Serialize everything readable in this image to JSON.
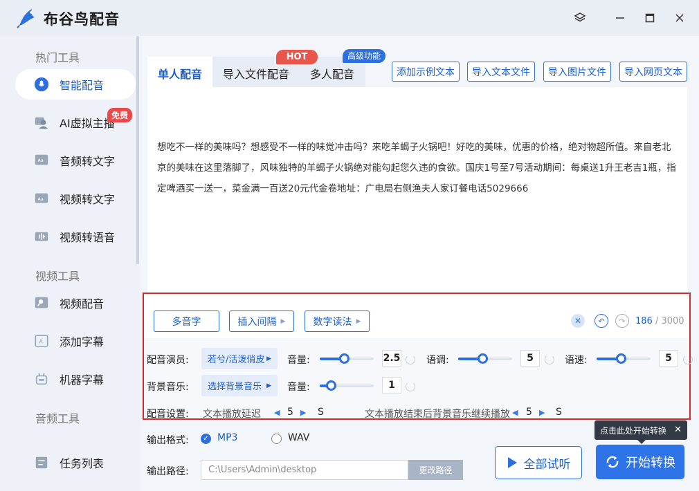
{
  "app": {
    "title": "布谷鸟配音"
  },
  "sidebar": {
    "sections": [
      "热门工具",
      "视频工具",
      "音频工具"
    ],
    "items": [
      {
        "label": "智能配音",
        "icon": "microphone-icon",
        "active": true
      },
      {
        "label": "AI虚拟主播",
        "icon": "avatar-icon",
        "badge": "免费"
      },
      {
        "label": "音频转文字",
        "icon": "audio-text-icon"
      },
      {
        "label": "视频转文字",
        "icon": "video-text-icon"
      },
      {
        "label": "视频转语音",
        "icon": "video-voice-icon"
      },
      {
        "label": "视频配音",
        "icon": "video-dub-icon"
      },
      {
        "label": "添加字幕",
        "icon": "subtitle-icon"
      },
      {
        "label": "机器字幕",
        "icon": "robot-icon"
      },
      {
        "label": "任务列表",
        "icon": "task-list-icon"
      }
    ]
  },
  "tabs": [
    {
      "label": "单人配音",
      "active": true
    },
    {
      "label": "导入文件配音"
    },
    {
      "label": "多人配音"
    }
  ],
  "badges": {
    "hot": "HOT",
    "pro": "高级功能"
  },
  "toolbar": {
    "add_example": "添加示例文本",
    "import_text": "导入文本文件",
    "import_image": "导入图片文件",
    "import_web": "导入网页文本"
  },
  "editor": {
    "text": "想吃不一样的美味吗？想感受不一样的味觉冲击吗？来吃羊蝎子火锅吧！好吃的美味，优惠的价格，绝对物超所值。来自老北京的美味在这里落脚了，风味独特的羊蝎子火锅绝对能勾起您久违的食欲。国庆1号至7号活动期间：每桌送1升王老吉1瓶，指定啤酒买一送一，菜金满一百送20元代金卷地址：广电局右侧渔夫人家订餐电话5029666",
    "char_count": "186",
    "char_max": "/ 3000"
  },
  "tools": {
    "polyphone": "多音字",
    "insert_pause": "插入间隔",
    "number_read": "数字读法"
  },
  "voice": {
    "actor_label": "配音演员:",
    "actor_value": "若兮/活泼俏皮",
    "volume_label": "音量:",
    "volume_value": "2.5",
    "volume_level": 0.45,
    "pitch_label": "语调:",
    "pitch_value": "5",
    "pitch_level": 0.45,
    "speed_label": "语速:",
    "speed_value": "5",
    "speed_level": 0.45
  },
  "bgm": {
    "label": "背景音乐:",
    "value": "选择背景音乐",
    "volume_label": "音量:",
    "volume_value": "1",
    "volume_level": 0.2
  },
  "settings": {
    "label": "配音设置:",
    "delay_label": "文本播放延迟",
    "delay_value": "5",
    "delay_unit": "S",
    "continue_label": "文本播放结束后背景音乐继续播放",
    "continue_value": "5",
    "continue_unit": "S"
  },
  "output": {
    "format_label": "输出格式:",
    "format_mp3": "MP3",
    "format_wav": "WAV",
    "selected": "MP3",
    "path_label": "输出路径:",
    "path_value": "C:\\Users\\Admin\\desktop",
    "change_path": "更改路径"
  },
  "actions": {
    "preview_all": "全部试听",
    "start": "开始转换",
    "tooltip": "点击此处开始转换"
  },
  "colors": {
    "accent": "#2e6fe0",
    "highlight_border": "#d52a2a",
    "hot": "#e8554a"
  }
}
